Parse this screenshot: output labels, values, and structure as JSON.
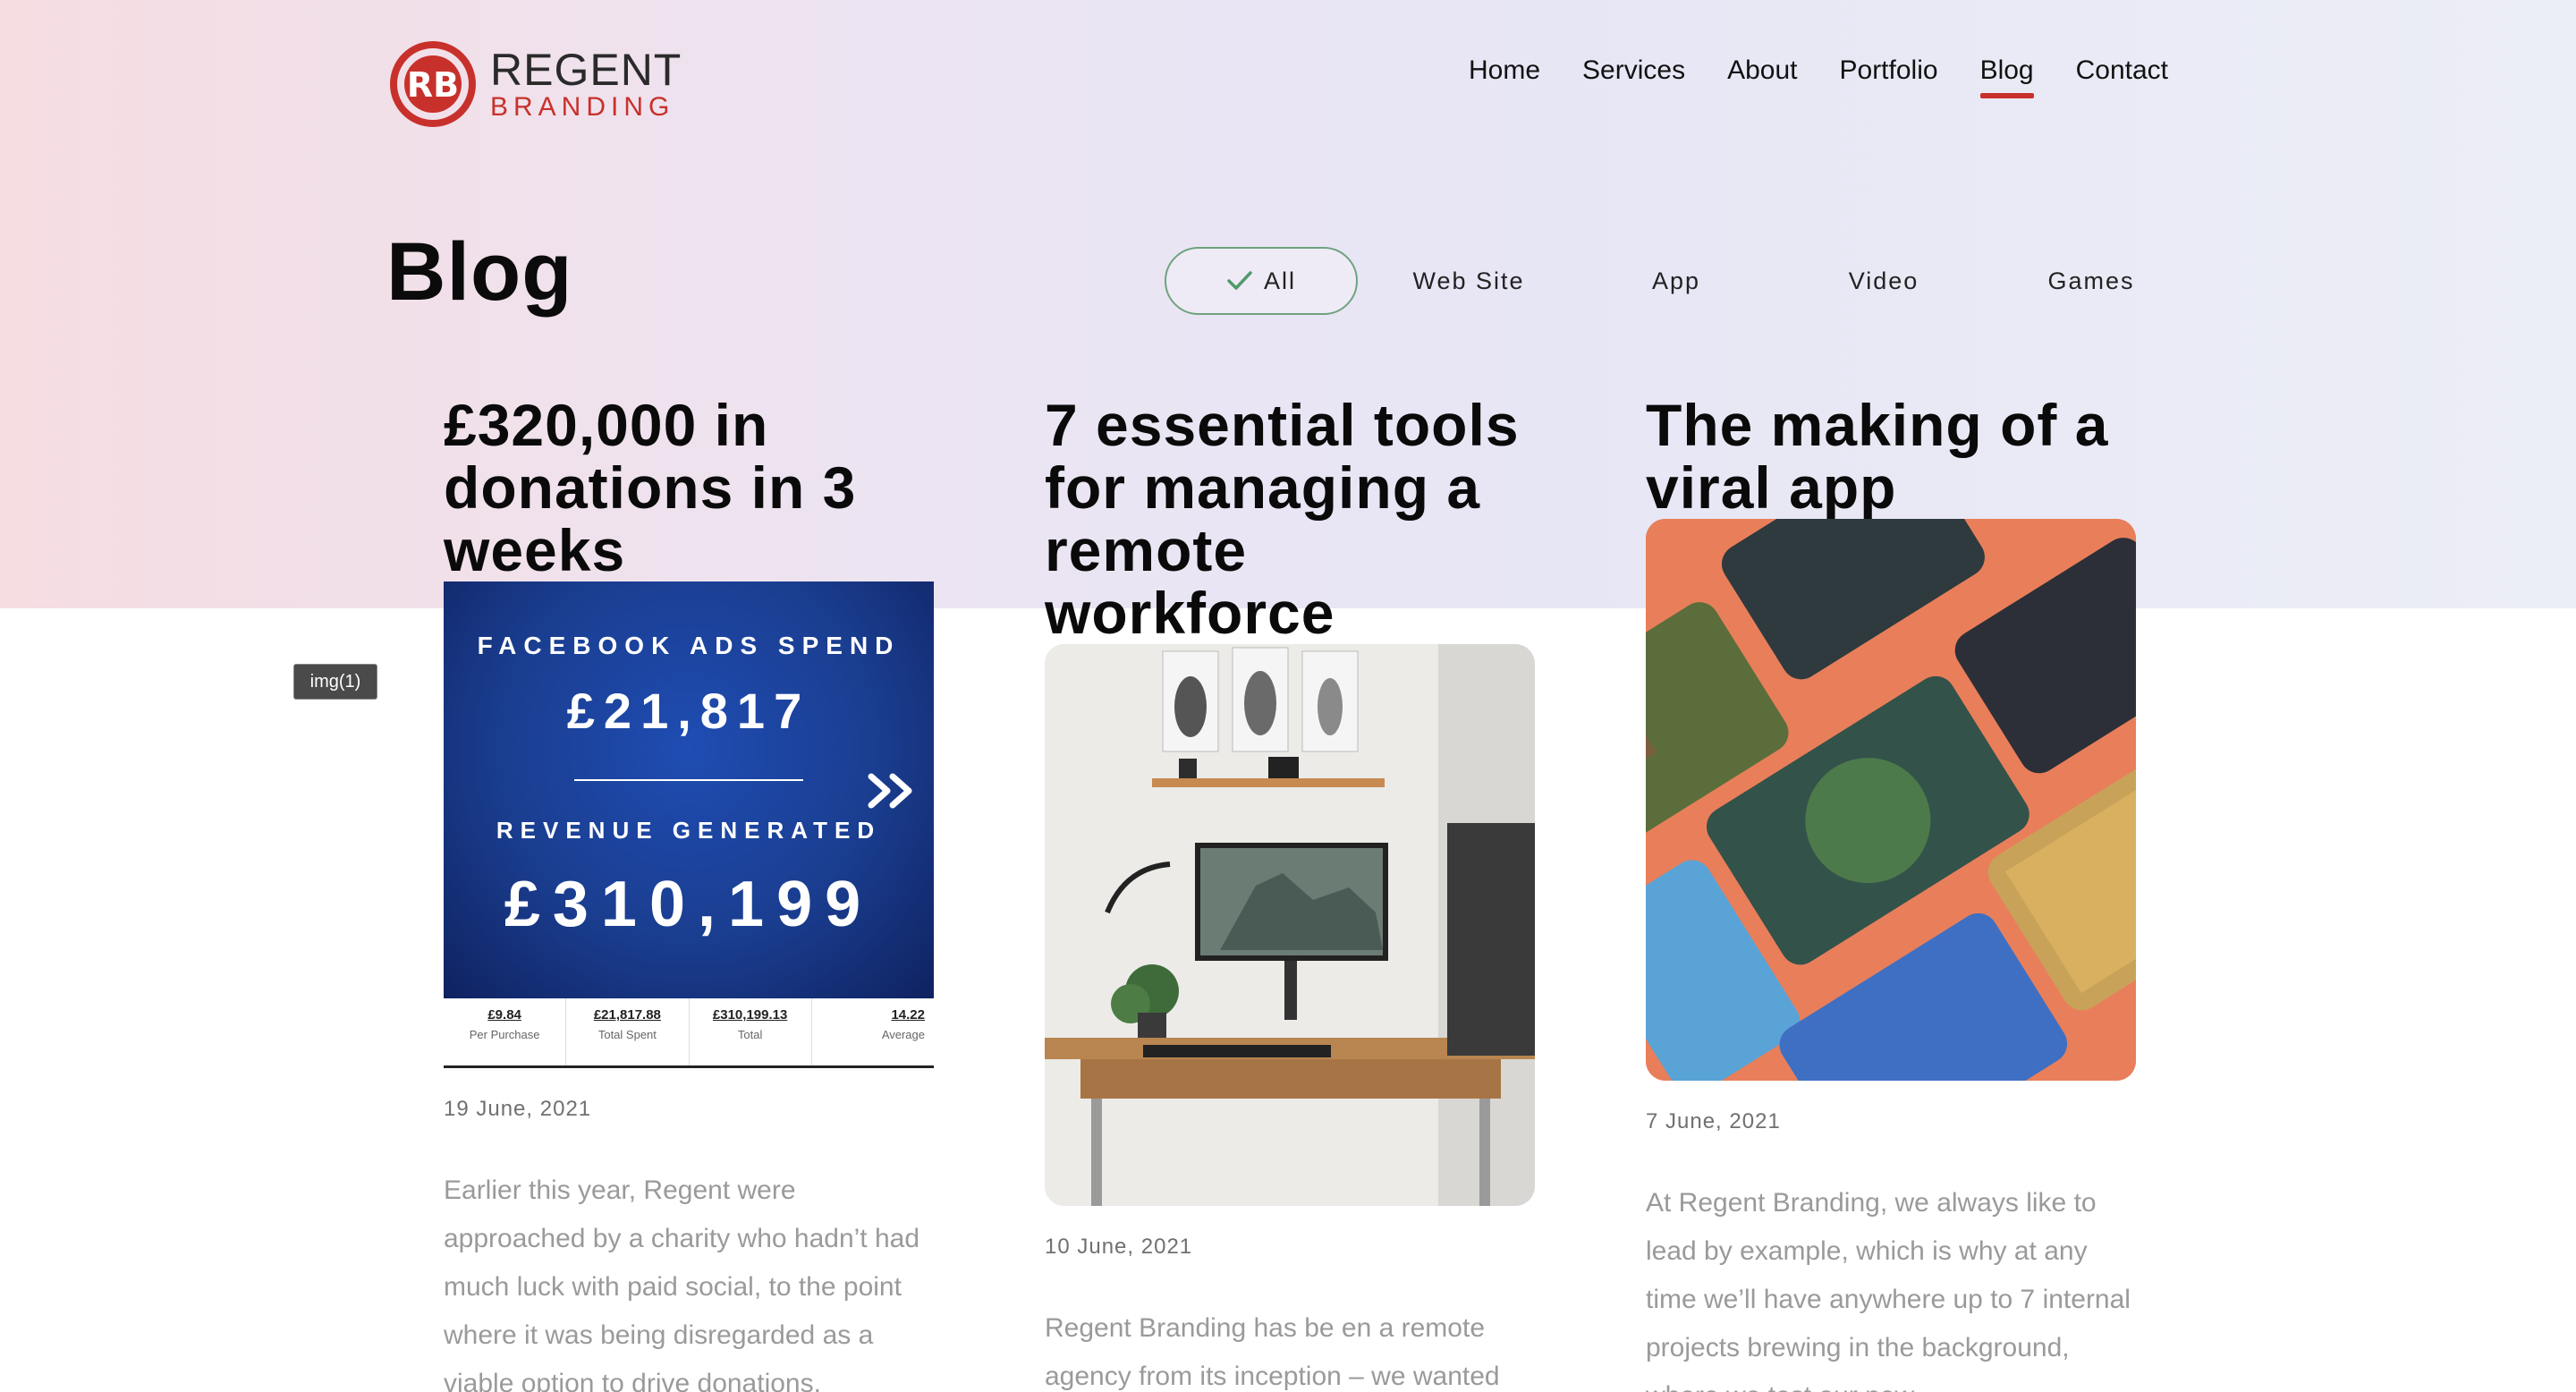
{
  "brand": {
    "name_top": "REGENT",
    "name_bottom": "BRANDING",
    "accent": "#c8312b"
  },
  "nav": {
    "items": [
      {
        "label": "Home",
        "active": false
      },
      {
        "label": "Services",
        "active": false
      },
      {
        "label": "About",
        "active": false
      },
      {
        "label": "Portfolio",
        "active": false
      },
      {
        "label": "Blog",
        "active": true
      },
      {
        "label": "Contact",
        "active": false
      }
    ]
  },
  "page": {
    "title": "Blog"
  },
  "filters": {
    "items": [
      {
        "label": "All",
        "selected": true
      },
      {
        "label": "Web Site",
        "selected": false
      },
      {
        "label": "App",
        "selected": false
      },
      {
        "label": "Video",
        "selected": false
      },
      {
        "label": "Games",
        "selected": false
      }
    ]
  },
  "posts": [
    {
      "title": "£320,000 in donations in 3 weeks",
      "date": "19 June, 2021",
      "excerpt": "Earlier this year, Regent were approached by a charity who hadn’t had much luck with paid social, to the point where it was being disregarded as a viable option to drive donations.",
      "image": {
        "label1": "FACEBOOK ADS SPEND",
        "value1": "£21,817",
        "label2": "REVENUE GENERATED",
        "value2": "£310,199",
        "stats": [
          {
            "value": "£9.84",
            "label": "Per Purchase"
          },
          {
            "value": "£21,817.88",
            "label": "Total Spent"
          },
          {
            "value": "£310,199.13",
            "label": "Total"
          },
          {
            "value": "14.22",
            "label": "Average"
          }
        ]
      }
    },
    {
      "title": "7 essential tools for managing a remote workforce",
      "date": "10 June, 2021",
      "excerpt": "Regent Branding has be en a remote agency from its inception – we wanted"
    },
    {
      "title": "The making of a viral app",
      "date": "7 June, 2021",
      "excerpt": "At Regent Branding, we always like to lead by example, which is why at any time we’ll have anywhere up to 7 internal projects brewing in the background, where we test our new"
    }
  ],
  "inspector_badge": "img(1)"
}
